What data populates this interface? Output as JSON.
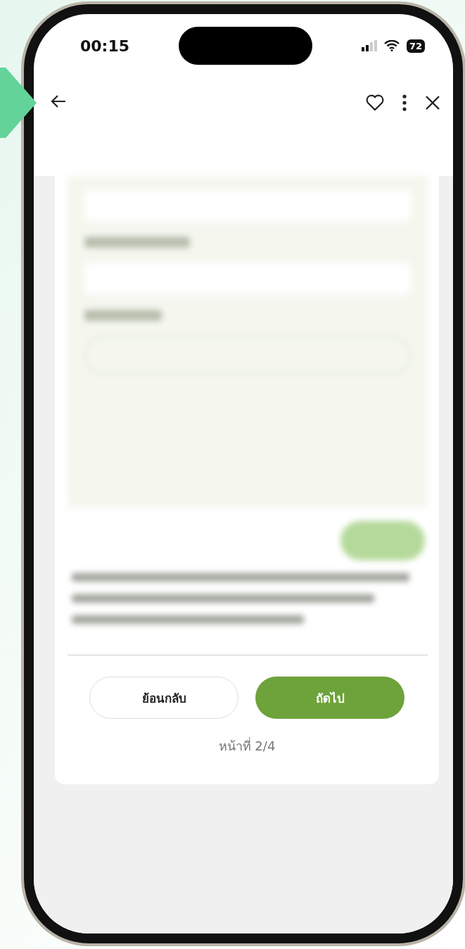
{
  "status_bar": {
    "time": "00:15",
    "battery": "72"
  },
  "footer": {
    "buttons": [
      {
        "label": "ย้อนกลับ",
        "kind": "secondary"
      },
      {
        "label": "ถัดไป",
        "kind": "primary"
      }
    ],
    "page_indicator": "หน้าที่ 2/4"
  }
}
